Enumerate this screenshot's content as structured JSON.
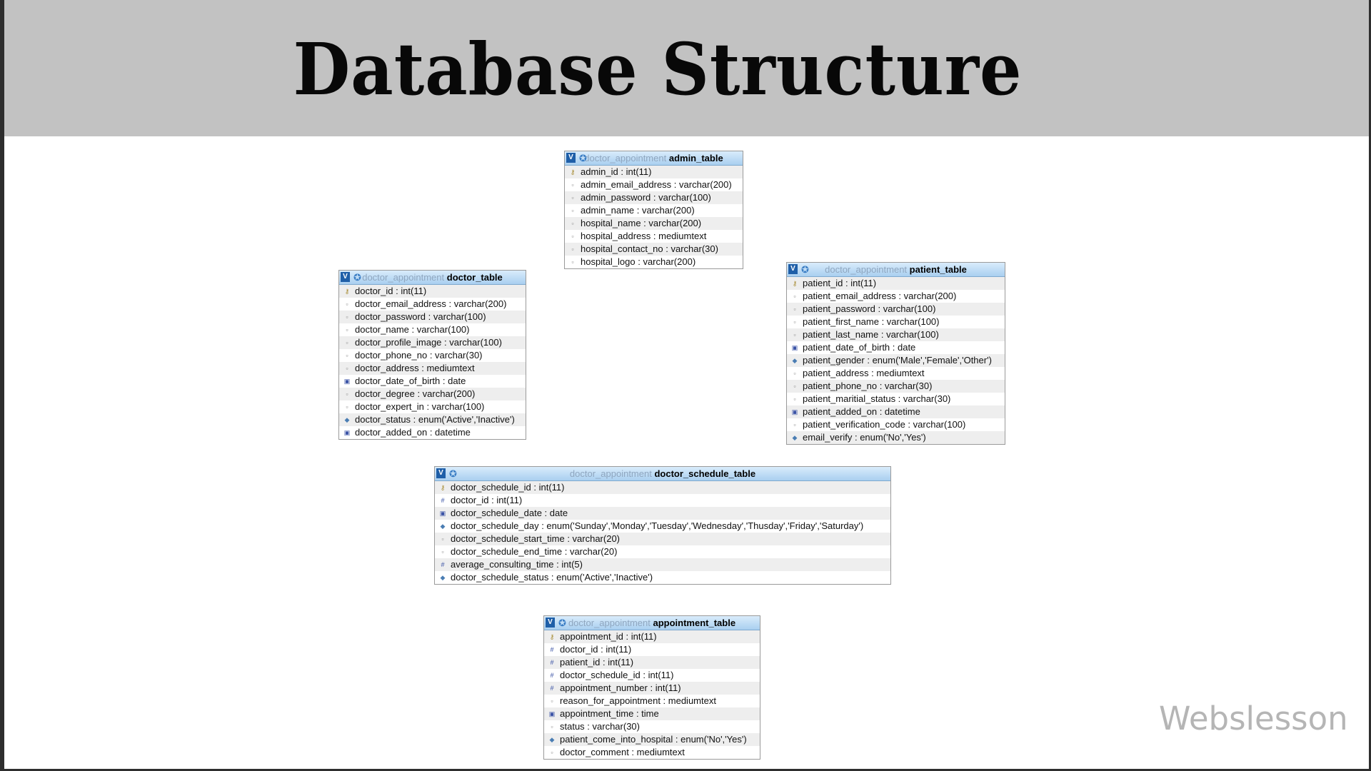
{
  "title": "Database Structure",
  "watermark": "Webslesson",
  "tables": {
    "admin": {
      "db": "doctor_appointment",
      "name": "admin_table",
      "columns": [
        {
          "kind": "primary",
          "text": "admin_id : int(11)"
        },
        {
          "kind": "text",
          "text": "admin_email_address : varchar(200)"
        },
        {
          "kind": "text",
          "text": "admin_password : varchar(100)"
        },
        {
          "kind": "text",
          "text": "admin_name : varchar(200)"
        },
        {
          "kind": "text",
          "text": "hospital_name : varchar(200)"
        },
        {
          "kind": "text",
          "text": "hospital_address : mediumtext"
        },
        {
          "kind": "text",
          "text": "hospital_contact_no : varchar(30)"
        },
        {
          "kind": "text",
          "text": "hospital_logo : varchar(200)"
        }
      ]
    },
    "doctor": {
      "db": "doctor_appointment",
      "name": "doctor_table",
      "columns": [
        {
          "kind": "primary",
          "text": "doctor_id : int(11)"
        },
        {
          "kind": "text",
          "text": "doctor_email_address : varchar(200)"
        },
        {
          "kind": "text",
          "text": "doctor_password : varchar(100)"
        },
        {
          "kind": "text",
          "text": "doctor_name : varchar(100)"
        },
        {
          "kind": "text",
          "text": "doctor_profile_image : varchar(100)"
        },
        {
          "kind": "text",
          "text": "doctor_phone_no : varchar(30)"
        },
        {
          "kind": "text",
          "text": "doctor_address : mediumtext"
        },
        {
          "kind": "date",
          "text": "doctor_date_of_birth : date"
        },
        {
          "kind": "text",
          "text": "doctor_degree : varchar(200)"
        },
        {
          "kind": "text",
          "text": "doctor_expert_in : varchar(100)"
        },
        {
          "kind": "enum",
          "text": "doctor_status : enum('Active','Inactive')"
        },
        {
          "kind": "date",
          "text": "doctor_added_on : datetime"
        }
      ]
    },
    "patient": {
      "db": "doctor_appointment",
      "name": "patient_table",
      "columns": [
        {
          "kind": "primary",
          "text": "patient_id : int(11)"
        },
        {
          "kind": "text",
          "text": "patient_email_address : varchar(200)"
        },
        {
          "kind": "text",
          "text": "patient_password : varchar(100)"
        },
        {
          "kind": "text",
          "text": "patient_first_name : varchar(100)"
        },
        {
          "kind": "text",
          "text": "patient_last_name : varchar(100)"
        },
        {
          "kind": "date",
          "text": "patient_date_of_birth : date"
        },
        {
          "kind": "enum",
          "text": "patient_gender : enum('Male','Female','Other')"
        },
        {
          "kind": "text",
          "text": "patient_address : mediumtext"
        },
        {
          "kind": "text",
          "text": "patient_phone_no : varchar(30)"
        },
        {
          "kind": "text",
          "text": "patient_maritial_status : varchar(30)"
        },
        {
          "kind": "date",
          "text": "patient_added_on : datetime"
        },
        {
          "kind": "text",
          "text": "patient_verification_code : varchar(100)"
        },
        {
          "kind": "enum",
          "text": "email_verify : enum('No','Yes')"
        }
      ]
    },
    "schedule": {
      "db": "doctor_appointment",
      "name": "doctor_schedule_table",
      "columns": [
        {
          "kind": "primary",
          "text": "doctor_schedule_id : int(11)"
        },
        {
          "kind": "foreign",
          "text": "doctor_id : int(11)"
        },
        {
          "kind": "date",
          "text": "doctor_schedule_date : date"
        },
        {
          "kind": "enum",
          "text": "doctor_schedule_day : enum('Sunday','Monday','Tuesday','Wednesday','Thusday','Friday','Saturday')"
        },
        {
          "kind": "text",
          "text": "doctor_schedule_start_time : varchar(20)"
        },
        {
          "kind": "text",
          "text": "doctor_schedule_end_time : varchar(20)"
        },
        {
          "kind": "foreign",
          "text": "average_consulting_time : int(5)"
        },
        {
          "kind": "enum",
          "text": "doctor_schedule_status : enum('Active','Inactive')"
        }
      ]
    },
    "appointment": {
      "db": "doctor_appointment",
      "name": "appointment_table",
      "columns": [
        {
          "kind": "primary",
          "text": "appointment_id : int(11)"
        },
        {
          "kind": "foreign",
          "text": "doctor_id : int(11)"
        },
        {
          "kind": "foreign",
          "text": "patient_id : int(11)"
        },
        {
          "kind": "foreign",
          "text": "doctor_schedule_id : int(11)"
        },
        {
          "kind": "foreign",
          "text": "appointment_number : int(11)"
        },
        {
          "kind": "text",
          "text": "reason_for_appointment : mediumtext"
        },
        {
          "kind": "date",
          "text": "appointment_time : time"
        },
        {
          "kind": "text",
          "text": "status : varchar(30)"
        },
        {
          "kind": "enum",
          "text": "patient_come_into_hospital : enum('No','Yes')"
        },
        {
          "kind": "text",
          "text": "doctor_comment : mediumtext"
        }
      ]
    }
  }
}
